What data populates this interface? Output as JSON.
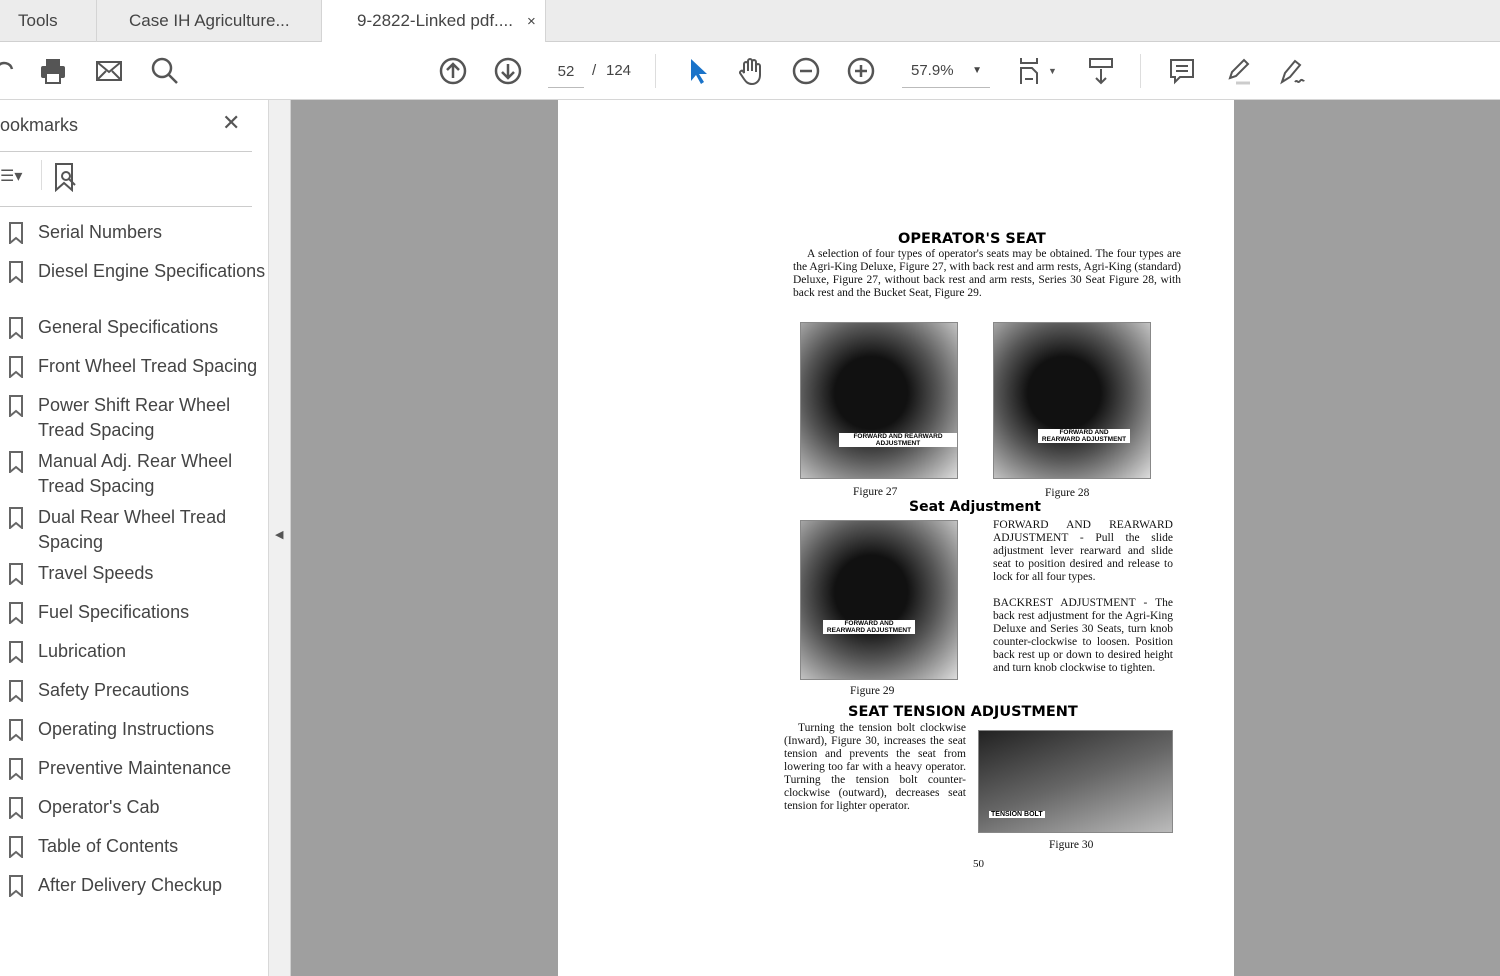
{
  "tabs": [
    {
      "label": "Tools"
    },
    {
      "label": "Case IH Agriculture..."
    },
    {
      "label": "9-2822-Linked pdf....",
      "close": "×"
    }
  ],
  "toolbar": {
    "page_current": "52",
    "page_separator": "/",
    "page_total": "124",
    "zoom": "57.9%",
    "accent": "#1a73c9"
  },
  "sidebar": {
    "title": "ookmarks",
    "close": "✕",
    "items": [
      {
        "label": "Serial Numbers"
      },
      {
        "label": "Diesel Engine Specifications"
      },
      {
        "label": "General Specifications"
      },
      {
        "label": "Front Wheel Tread Spacing"
      },
      {
        "label": "Power Shift Rear Wheel Tread Spacing"
      },
      {
        "label": "Manual Adj. Rear Wheel Tread Spacing"
      },
      {
        "label": "Dual Rear Wheel Tread Spacing"
      },
      {
        "label": "Travel Speeds"
      },
      {
        "label": "Fuel Specifications"
      },
      {
        "label": "Lubrication"
      },
      {
        "label": "Safety Precautions"
      },
      {
        "label": "Operating Instructions"
      },
      {
        "label": "Preventive Maintenance"
      },
      {
        "label": "Operator's Cab"
      },
      {
        "label": "Table of Contents"
      },
      {
        "label": "After Delivery Checkup"
      }
    ]
  },
  "doc": {
    "heading1": "OPERATOR'S SEAT",
    "intro": "A selection of four types of operator's seats may be obtained. The four types are the Agri-King Deluxe, Figure 27, with back rest and arm rests, Agri-King (standard) Deluxe, Figure 27, without back rest and arm rests, Series 30 Seat Figure 28, with back rest and the Bucket Seat, Figure 29.",
    "fig27": "Figure 27",
    "fig28": "Figure 28",
    "fig29": "Figure 29",
    "fig30": "Figure 30",
    "fig_label": "FORWARD AND REARWARD ADJUSTMENT",
    "tension_label": "TENSION BOLT",
    "heading2": "Seat Adjustment",
    "adjust": "FORWARD AND REARWARD ADJUSTMENT - Pull the slide adjustment lever rearward and slide seat to position desired and release to lock for all four types.",
    "backrest": "BACKREST ADJUSTMENT - The back rest adjustment for the Agri-King Deluxe and Series 30 Seats, turn knob counter-clockwise to loosen. Position back rest up or down to desired height and turn knob clockwise to tighten.",
    "heading3": "SEAT TENSION ADJUSTMENT",
    "tension": "Turning the tension bolt clockwise (Inward), Figure 30, increases the seat tension and prevents the seat from lowering too far with a heavy operator. Turning the tension bolt counter-clockwise (outward), decreases seat tension for lighter operator.",
    "page_number": "50"
  }
}
